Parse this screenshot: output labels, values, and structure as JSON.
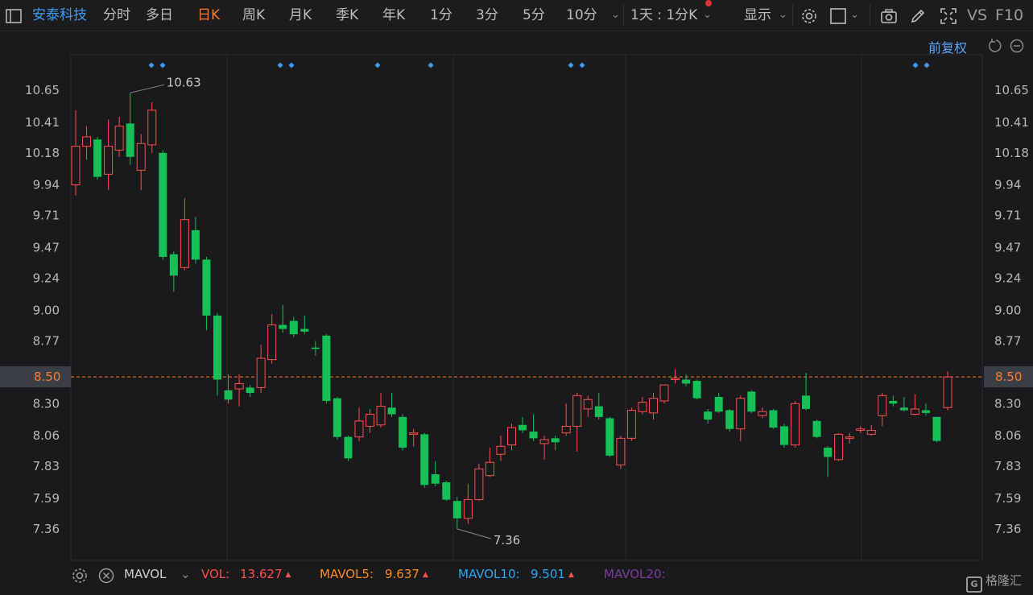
{
  "toolbar": {
    "stock_name": "安泰科技",
    "periods": [
      "分时",
      "多日",
      "日K",
      "周K",
      "月K",
      "季K",
      "年K",
      "1分",
      "3分",
      "5分",
      "10分"
    ],
    "active_period": "日K",
    "multi_period": "1天 : 1分K",
    "display_label": "显示",
    "vs_label": "VS",
    "f10_label": "F10"
  },
  "chart": {
    "adjust_label": "前复权",
    "y_ticks": [
      "10.65",
      "10.41",
      "10.18",
      "9.94",
      "9.71",
      "9.47",
      "9.24",
      "9.00",
      "8.77",
      "8.50",
      "8.30",
      "8.06",
      "7.83",
      "7.59",
      "7.36"
    ],
    "current_price": "8.50",
    "high_label": "10.63",
    "low_label": "7.36",
    "colors": {
      "up": "#ff4d4d",
      "down": "#15c156",
      "marker": "#3e9bf5",
      "price_line": "#ff7a2e"
    },
    "candles": [
      {
        "o": 9.94,
        "c": 10.23,
        "h": 10.5,
        "l": 9.86
      },
      {
        "o": 10.23,
        "c": 10.3,
        "h": 10.38,
        "l": 10.13
      },
      {
        "o": 10.28,
        "c": 10.0,
        "h": 10.3,
        "l": 9.98
      },
      {
        "o": 10.02,
        "c": 10.23,
        "h": 10.43,
        "l": 9.9
      },
      {
        "o": 10.2,
        "c": 10.38,
        "h": 10.45,
        "l": 10.15
      },
      {
        "o": 10.4,
        "c": 10.15,
        "h": 10.63,
        "l": 10.09
      },
      {
        "o": 10.05,
        "c": 10.25,
        "h": 10.32,
        "l": 9.9
      },
      {
        "o": 10.24,
        "c": 10.5,
        "h": 10.56,
        "l": 10.18
      },
      {
        "o": 10.18,
        "c": 9.4,
        "h": 10.2,
        "l": 9.38
      },
      {
        "o": 9.42,
        "c": 9.26,
        "h": 9.44,
        "l": 9.14
      },
      {
        "o": 9.32,
        "c": 9.68,
        "h": 9.84,
        "l": 9.3
      },
      {
        "o": 9.6,
        "c": 9.38,
        "h": 9.7,
        "l": 9.35
      },
      {
        "o": 9.38,
        "c": 8.96,
        "h": 9.4,
        "l": 8.85
      },
      {
        "o": 8.96,
        "c": 8.48,
        "h": 8.98,
        "l": 8.36
      },
      {
        "o": 8.4,
        "c": 8.33,
        "h": 8.52,
        "l": 8.3
      },
      {
        "o": 8.41,
        "c": 8.45,
        "h": 8.52,
        "l": 8.28
      },
      {
        "o": 8.42,
        "c": 8.38,
        "h": 8.44,
        "l": 8.35
      },
      {
        "o": 8.42,
        "c": 8.64,
        "h": 8.74,
        "l": 8.38
      },
      {
        "o": 8.63,
        "c": 8.89,
        "h": 8.97,
        "l": 8.6
      },
      {
        "o": 8.89,
        "c": 8.86,
        "h": 9.04,
        "l": 8.83
      },
      {
        "o": 8.92,
        "c": 8.82,
        "h": 8.95,
        "l": 8.8
      },
      {
        "o": 8.86,
        "c": 8.84,
        "h": 8.96,
        "l": 8.82
      },
      {
        "o": 8.72,
        "c": 8.71,
        "h": 8.77,
        "l": 8.66
      },
      {
        "o": 8.81,
        "c": 8.32,
        "h": 8.82,
        "l": 8.3
      },
      {
        "o": 8.34,
        "c": 8.05,
        "h": 8.35,
        "l": 8.03
      },
      {
        "o": 8.05,
        "c": 7.89,
        "h": 8.06,
        "l": 7.87
      },
      {
        "o": 8.05,
        "c": 8.17,
        "h": 8.27,
        "l": 8.02
      },
      {
        "o": 8.13,
        "c": 8.22,
        "h": 8.26,
        "l": 8.08
      },
      {
        "o": 8.14,
        "c": 8.28,
        "h": 8.38,
        "l": 8.12
      },
      {
        "o": 8.27,
        "c": 8.22,
        "h": 8.38,
        "l": 8.2
      },
      {
        "o": 8.2,
        "c": 7.97,
        "h": 8.22,
        "l": 7.95
      },
      {
        "o": 8.07,
        "c": 8.08,
        "h": 8.11,
        "l": 7.98
      },
      {
        "o": 8.07,
        "c": 7.69,
        "h": 8.08,
        "l": 7.67
      },
      {
        "o": 7.77,
        "c": 7.7,
        "h": 7.87,
        "l": 7.68
      },
      {
        "o": 7.71,
        "c": 7.58,
        "h": 7.72,
        "l": 7.57
      },
      {
        "o": 7.57,
        "c": 7.44,
        "h": 7.6,
        "l": 7.36
      },
      {
        "o": 7.44,
        "c": 7.58,
        "h": 7.7,
        "l": 7.4
      },
      {
        "o": 7.58,
        "c": 7.81,
        "h": 7.85,
        "l": 7.57
      },
      {
        "o": 7.76,
        "c": 7.86,
        "h": 7.97,
        "l": 7.75
      },
      {
        "o": 7.92,
        "c": 7.98,
        "h": 8.06,
        "l": 7.87
      },
      {
        "o": 7.99,
        "c": 8.12,
        "h": 8.15,
        "l": 7.95
      },
      {
        "o": 8.14,
        "c": 8.1,
        "h": 8.2,
        "l": 8.08
      },
      {
        "o": 8.09,
        "c": 8.04,
        "h": 8.22,
        "l": 8.02
      },
      {
        "o": 8.0,
        "c": 8.03,
        "h": 8.06,
        "l": 7.88
      },
      {
        "o": 8.04,
        "c": 8.01,
        "h": 8.06,
        "l": 7.95
      },
      {
        "o": 8.08,
        "c": 8.13,
        "h": 8.3,
        "l": 8.06
      },
      {
        "o": 8.13,
        "c": 8.36,
        "h": 8.38,
        "l": 7.94
      },
      {
        "o": 8.26,
        "c": 8.33,
        "h": 8.36,
        "l": 8.2
      },
      {
        "o": 8.28,
        "c": 8.2,
        "h": 8.38,
        "l": 8.18
      },
      {
        "o": 8.19,
        "c": 7.91,
        "h": 8.2,
        "l": 7.9
      },
      {
        "o": 7.84,
        "c": 8.04,
        "h": 8.06,
        "l": 7.81
      },
      {
        "o": 8.04,
        "c": 8.25,
        "h": 8.27,
        "l": 8.02
      },
      {
        "o": 8.24,
        "c": 8.31,
        "h": 8.35,
        "l": 8.22
      },
      {
        "o": 8.23,
        "c": 8.34,
        "h": 8.38,
        "l": 8.18
      },
      {
        "o": 8.32,
        "c": 8.44,
        "h": 8.44,
        "l": 8.3
      },
      {
        "o": 8.48,
        "c": 8.49,
        "h": 8.56,
        "l": 8.45
      },
      {
        "o": 8.48,
        "c": 8.45,
        "h": 8.52,
        "l": 8.43
      },
      {
        "o": 8.47,
        "c": 8.34,
        "h": 8.48,
        "l": 8.33
      },
      {
        "o": 8.24,
        "c": 8.18,
        "h": 8.26,
        "l": 8.15
      },
      {
        "o": 8.35,
        "c": 8.24,
        "h": 8.38,
        "l": 8.23
      },
      {
        "o": 8.25,
        "c": 8.11,
        "h": 8.26,
        "l": 8.09
      },
      {
        "o": 8.11,
        "c": 8.34,
        "h": 8.36,
        "l": 8.02
      },
      {
        "o": 8.39,
        "c": 8.24,
        "h": 8.4,
        "l": 8.23
      },
      {
        "o": 8.21,
        "c": 8.24,
        "h": 8.27,
        "l": 8.19
      },
      {
        "o": 8.25,
        "c": 8.12,
        "h": 8.26,
        "l": 8.11
      },
      {
        "o": 8.13,
        "c": 7.99,
        "h": 8.15,
        "l": 7.97
      },
      {
        "o": 7.99,
        "c": 8.3,
        "h": 8.32,
        "l": 7.97
      },
      {
        "o": 8.36,
        "c": 8.26,
        "h": 8.53,
        "l": 8.25
      },
      {
        "o": 8.17,
        "c": 8.05,
        "h": 8.18,
        "l": 8.04
      },
      {
        "o": 7.97,
        "c": 7.9,
        "h": 7.98,
        "l": 7.75
      },
      {
        "o": 7.88,
        "c": 8.07,
        "h": 8.08,
        "l": 7.87
      },
      {
        "o": 8.04,
        "c": 8.05,
        "h": 8.08,
        "l": 8.0
      },
      {
        "o": 8.1,
        "c": 8.11,
        "h": 8.13,
        "l": 8.08
      },
      {
        "o": 8.07,
        "c": 8.1,
        "h": 8.14,
        "l": 8.06
      },
      {
        "o": 8.21,
        "c": 8.36,
        "h": 8.38,
        "l": 8.13
      },
      {
        "o": 8.32,
        "c": 8.3,
        "h": 8.36,
        "l": 8.28
      },
      {
        "o": 8.27,
        "c": 8.25,
        "h": 8.35,
        "l": 8.24
      },
      {
        "o": 8.22,
        "c": 8.26,
        "h": 8.37,
        "l": 8.21
      },
      {
        "o": 8.25,
        "c": 8.23,
        "h": 8.3,
        "l": 8.21
      },
      {
        "o": 8.2,
        "c": 8.02,
        "h": 8.2,
        "l": 8.01
      },
      {
        "o": 8.27,
        "c": 8.5,
        "h": 8.54,
        "l": 8.25
      }
    ]
  },
  "volume_bar": {
    "indicator": "MAVOL",
    "vol_label": "VOL:",
    "vol_value": "13.627",
    "mavol5_label": "MAVOL5:",
    "mavol5_value": "9.637",
    "mavol10_label": "MAVOL10:",
    "mavol10_value": "9.501",
    "mavol20_label": "MAVOL20:",
    "colors": {
      "vol": "#ff4d4d",
      "mavol5": "#ff8c1a",
      "mavol10": "#2da8f0",
      "mavol20": "#9b3fc6"
    }
  },
  "logo": {
    "text": "格隆汇"
  }
}
